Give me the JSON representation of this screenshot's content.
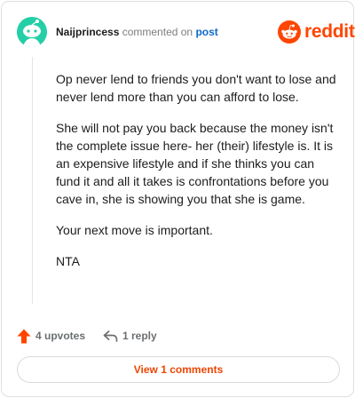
{
  "comment": {
    "username": "Naijprincess",
    "commented_on": "commented on",
    "post_link": "post",
    "paragraphs": [
      "Op never lend to friends you don't want to lose and never lend more than you can afford to lose.",
      "She will not pay you back because the money isn't the complete issue here- her (their) lifestyle is. It is an expensive lifestyle and if she thinks you can fund it and all it takes is confrontations before you cave in, she is showing you that she is game.",
      "Your next move is important.",
      "NTA"
    ]
  },
  "brand": {
    "wordmark": "reddit",
    "icon": "reddit-snoo-icon",
    "color": "#ff4500"
  },
  "avatar": {
    "icon": "snoo-avatar-icon",
    "color": "#24cfa8"
  },
  "actions": {
    "upvotes": "4 upvotes",
    "upvote_icon": "upvote-arrow-icon",
    "replies": "1 reply",
    "reply_icon": "reply-arrow-icon"
  },
  "view_comments_button": "View 1 comments"
}
